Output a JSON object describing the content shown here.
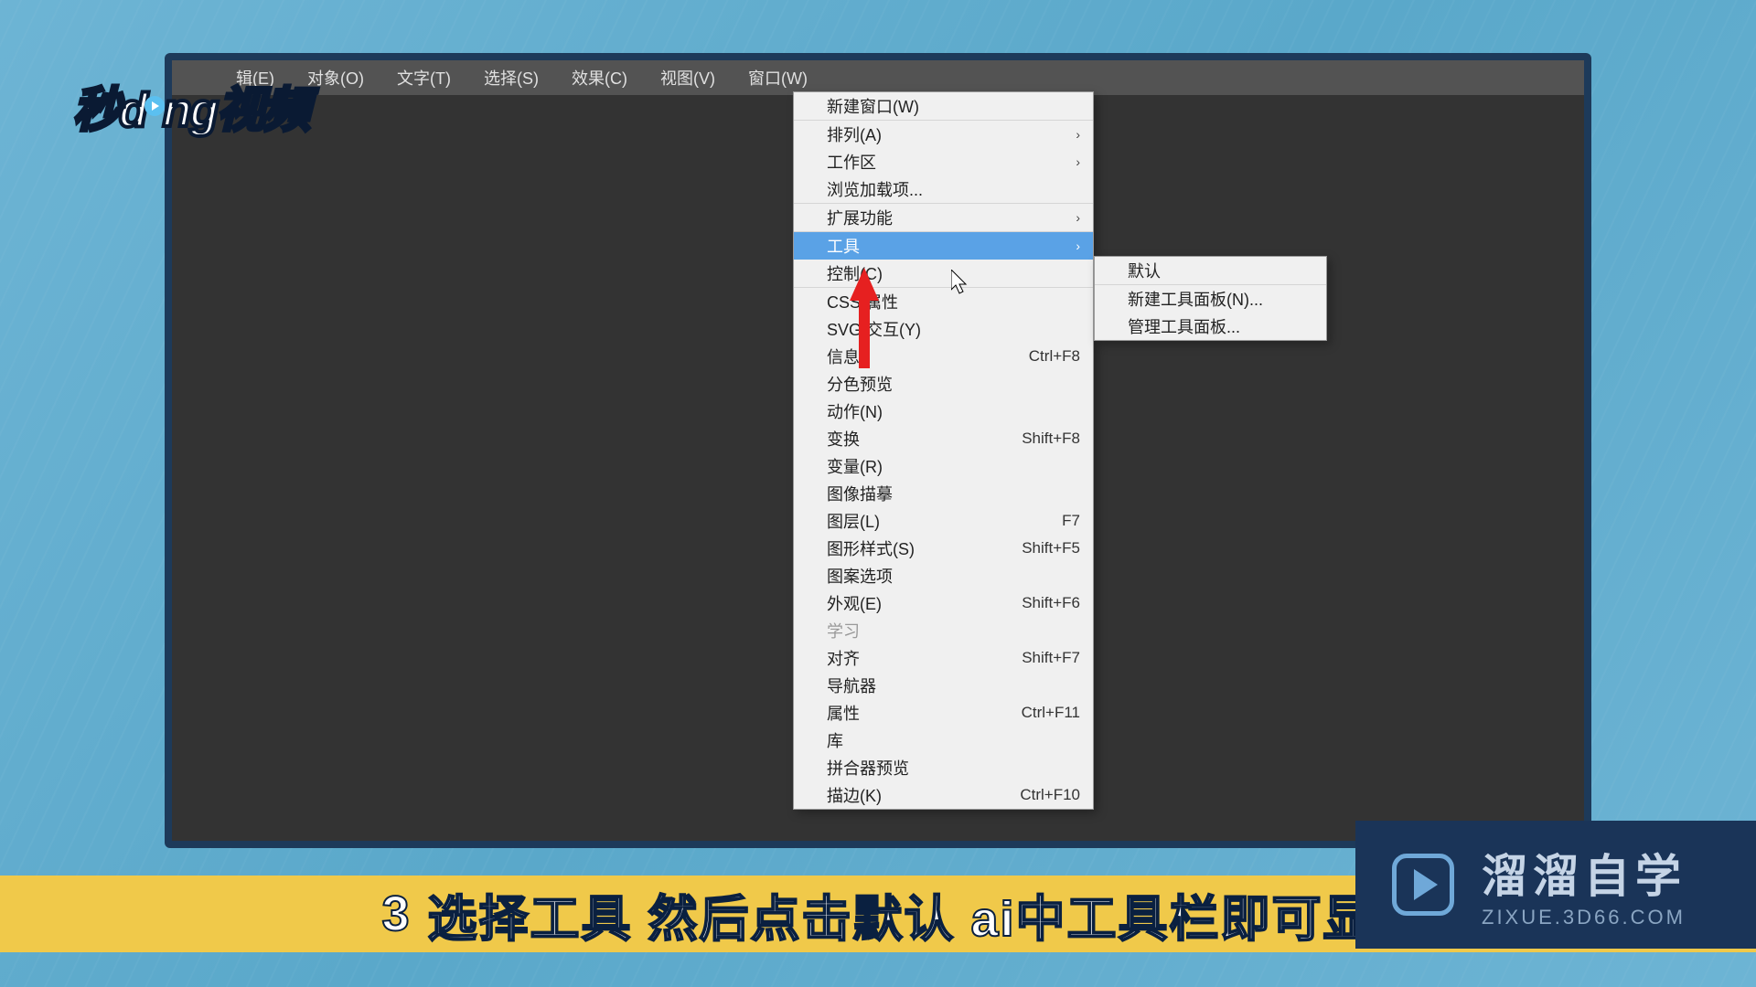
{
  "menubar": {
    "items": [
      {
        "label": "辑(E)"
      },
      {
        "label": "对象(O)"
      },
      {
        "label": "文字(T)"
      },
      {
        "label": "选择(S)"
      },
      {
        "label": "效果(C)"
      },
      {
        "label": "视图(V)"
      },
      {
        "label": "窗口(W)"
      }
    ]
  },
  "dropdown": {
    "sections": [
      {
        "items": [
          {
            "label": "新建窗口(W)"
          }
        ]
      },
      {
        "items": [
          {
            "label": "排列(A)",
            "submenu": true
          },
          {
            "label": "工作区",
            "submenu": true
          },
          {
            "label": "浏览加载项..."
          }
        ]
      },
      {
        "items": [
          {
            "label": "扩展功能",
            "submenu": true
          }
        ]
      },
      {
        "items": [
          {
            "label": "工具",
            "submenu": true,
            "highlighted": true
          },
          {
            "label": "控制(C)"
          }
        ]
      },
      {
        "items": [
          {
            "label": "CSS 属性"
          },
          {
            "label": "SVG 交互(Y)"
          },
          {
            "label": "信息",
            "shortcut": "Ctrl+F8"
          },
          {
            "label": "分色预览"
          },
          {
            "label": "动作(N)"
          },
          {
            "label": "变换",
            "shortcut": "Shift+F8"
          },
          {
            "label": "变量(R)"
          },
          {
            "label": "图像描摹"
          },
          {
            "label": "图层(L)",
            "shortcut": "F7"
          },
          {
            "label": "图形样式(S)",
            "shortcut": "Shift+F5"
          },
          {
            "label": "图案选项"
          },
          {
            "label": "外观(E)",
            "shortcut": "Shift+F6"
          },
          {
            "label": "学习",
            "disabled": true
          },
          {
            "label": "对齐",
            "shortcut": "Shift+F7"
          },
          {
            "label": "导航器"
          },
          {
            "label": "属性",
            "shortcut": "Ctrl+F11"
          },
          {
            "label": "库"
          },
          {
            "label": "拼合器预览"
          },
          {
            "label": "描边(K)",
            "shortcut": "Ctrl+F10"
          }
        ]
      }
    ]
  },
  "submenu": {
    "sections": [
      {
        "items": [
          {
            "label": "默认"
          }
        ]
      },
      {
        "items": [
          {
            "label": "新建工具面板(N)..."
          },
          {
            "label": "管理工具面板..."
          }
        ]
      }
    ]
  },
  "watermark": {
    "prefix": "秒d",
    "suffix": "ng视频"
  },
  "subtitle": {
    "number": "3",
    "text": "选择工具 然后点击默认 ai中工具栏即可显"
  },
  "brand": {
    "title": "溜溜自学",
    "url": "ZIXUE.3D66.COM"
  }
}
